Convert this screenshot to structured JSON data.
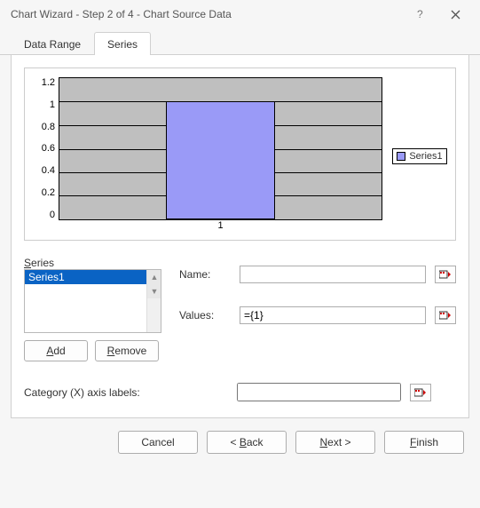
{
  "window": {
    "title": "Chart Wizard - Step 2 of 4 - Chart Source Data"
  },
  "tabs": {
    "data_range": "Data Range",
    "series": "Series"
  },
  "chart_data": {
    "type": "bar",
    "categories": [
      "1"
    ],
    "values": [
      1
    ],
    "ylim": [
      0,
      1.2
    ],
    "yticks": [
      "0",
      "0.2",
      "0.4",
      "0.6",
      "0.8",
      "1",
      "1.2"
    ],
    "series_name": "Series1",
    "legend_position": "right"
  },
  "series_panel": {
    "label": "Series",
    "items": [
      "Series1"
    ],
    "add_label": "Add",
    "remove_label": "Remove"
  },
  "fields": {
    "name_label": "Name:",
    "name_value": "",
    "values_label": "Values:",
    "values_value": "={1}",
    "category_label": "Category (X) axis labels:",
    "category_value": ""
  },
  "footer": {
    "cancel": "Cancel",
    "back": "< Back",
    "next": "Next >",
    "finish": "Finish"
  }
}
